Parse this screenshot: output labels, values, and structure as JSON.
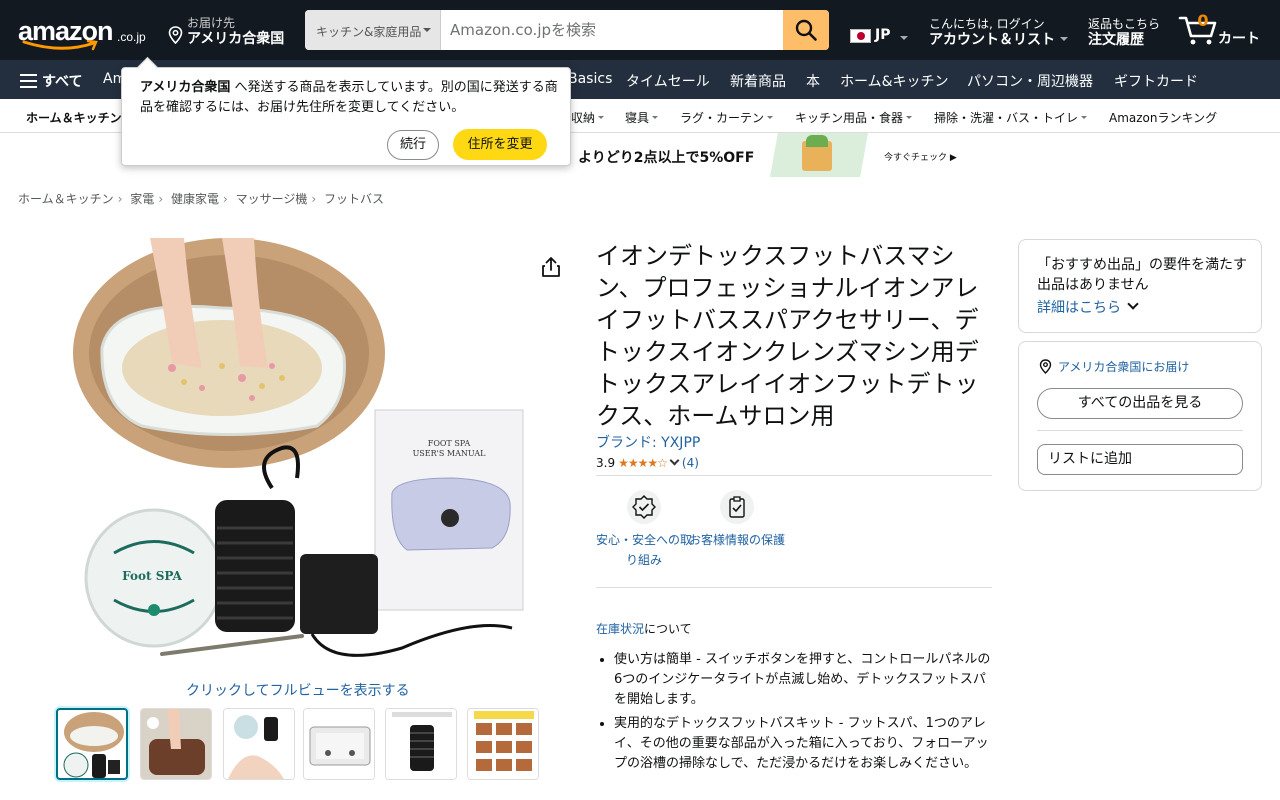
{
  "header": {
    "logo_text": "amazon",
    "logo_suffix": ".co.jp",
    "deliver_line1": "お届け先",
    "deliver_line2": "アメリカ合衆国",
    "search_category": "キッチン&家庭用品",
    "search_placeholder": "Amazon.co.jpを検索",
    "language_code": "JP",
    "account_line1": "こんにちは, ログイン",
    "account_line2": "アカウント＆リスト",
    "orders_line1": "返品もこちら",
    "orders_line2": "注文履歴",
    "cart_count": "0",
    "cart_label": "カート"
  },
  "nav": {
    "all_label": "すべて",
    "items": [
      "Am",
      "Basics",
      "タイムセール",
      "新着商品",
      "本",
      "ホーム&キッチン",
      "パソコン・周辺機器",
      "ギフトカード"
    ]
  },
  "subnav": {
    "items": [
      "ホーム＆キッチン",
      "収納",
      "寝具",
      "ラグ・カーテン",
      "キッチン用品・食器",
      "掃除・洗濯・バス・トイレ",
      "Amazonランキング"
    ]
  },
  "banner": {
    "promo_text": "よりどり2点以上で5%OFF",
    "cta_text": "今すぐチェック ▶"
  },
  "popover": {
    "message_bold": "アメリカ合衆国",
    "message_rest": " へ発送する商品を表示しています。別の国に発送する商品を確認するには、お届け先住所を変更してください。",
    "continue_label": "続行",
    "change_label": "住所を変更"
  },
  "breadcrumb": [
    "ホーム＆キッチン",
    "家電",
    "健康家電",
    "マッサージ機",
    "フットバス"
  ],
  "product": {
    "title": "イオンデトックスフットバスマシン、プロフェッショナルイオンアレイフットバススパアクセサリー、デトックスイオンクレンズマシン用デトックスアレイイオンフットデトックス、ホームサロン用",
    "brand": "ブランド: YXJPP",
    "rating_value": "3.9",
    "rating_stars": "★★★★☆",
    "rating_fraction": 0.78,
    "review_count": "(4)",
    "image_label_manual_1": "FOOT SPA",
    "image_label_manual_2": "USER'S MANUAL",
    "image_label_device": "Foot SPA",
    "fullview_label": "クリックしてフルビューを表示する",
    "trust_items": [
      "安心・安全への取り組み",
      "お客様情報の保護"
    ],
    "stock_link": "在庫状況",
    "stock_rest": "について",
    "bullets": [
      "使い方は簡単 - スイッチボタンを押すと、コントロールパネルの6つのインジケータライトが点滅し始め、デトックスフットスパを開始します。",
      "実用的なデトックスフットバスキット - フットスパ、1つのアレイ、その他の重要な部品が入った箱に入っており、フォローアップの浴槽の掃除なしで、ただ浸かるだけをお楽しみください。"
    ]
  },
  "buybox": {
    "no_offer_text": "「おすすめ出品」の要件を満たす出品はありません",
    "details_link": "詳細はこちら",
    "deliver_to": "アメリカ合衆国にお届け",
    "all_offers": "すべての出品を見る",
    "add_to_list": "リストに追加"
  },
  "colors": {
    "header_bg": "#131921",
    "nav_bg": "#232f3e",
    "search_button": "#febd69",
    "link": "#2162a1",
    "star": "#de7921",
    "yellow_button": "#ffd814",
    "cart_count": "#f08804"
  }
}
